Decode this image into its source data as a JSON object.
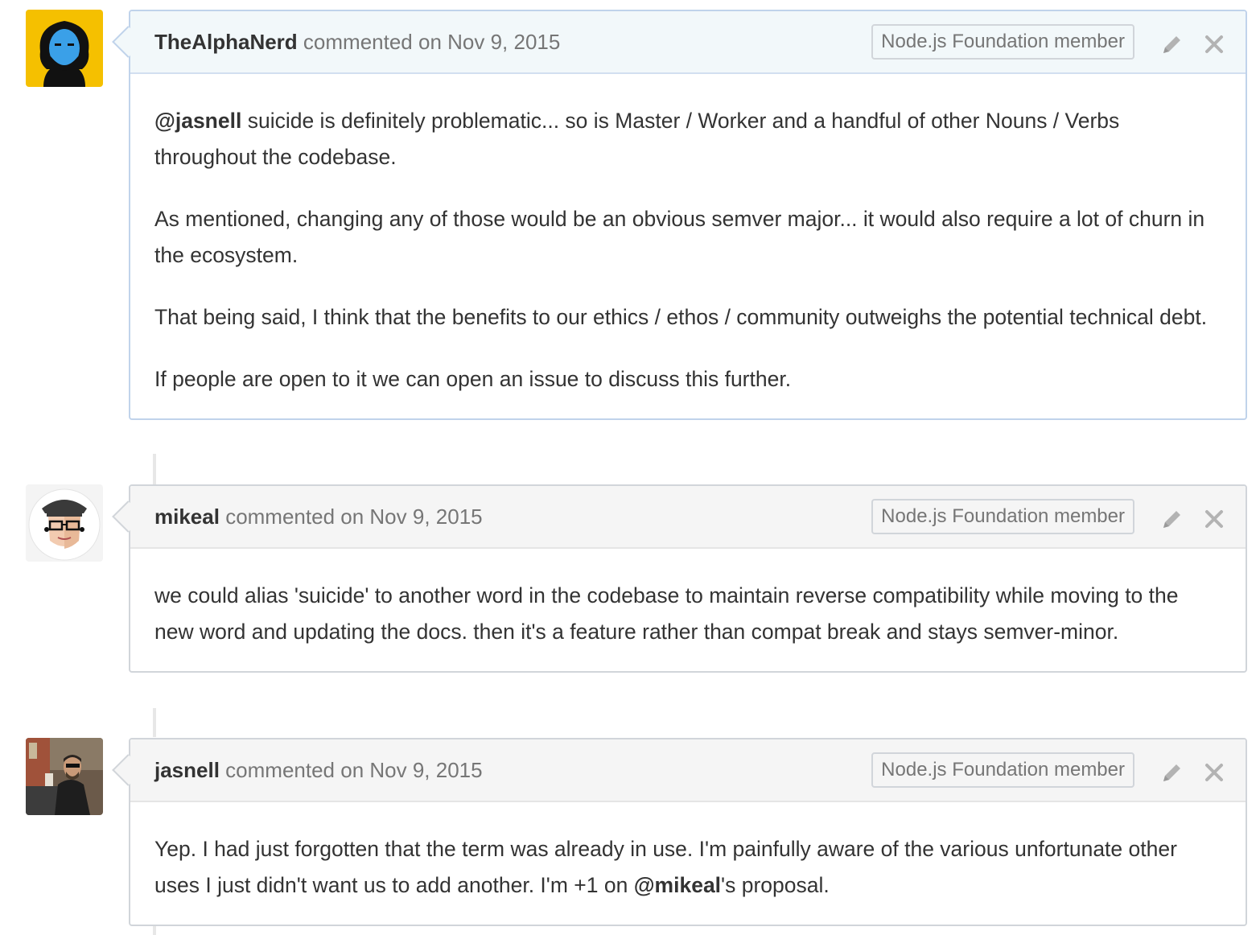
{
  "comments": [
    {
      "author": "TheAlphaNerd",
      "action": "commented on",
      "date": "Nov 9, 2015",
      "badge": "Node.js Foundation member",
      "paragraphs": [
        {
          "mention": "@jasnell",
          "text": " suicide is definitely problematic... so is Master / Worker and a handful of other Nouns / Verbs throughout the codebase."
        },
        {
          "text": "As mentioned, changing any of those would be an obvious semver major... it would also require a lot of churn in the ecosystem."
        },
        {
          "text": "That being said, I think that the benefits to our ethics / ethos / community outweighs the potential technical debt."
        },
        {
          "text": "If people are open to it we can open an issue to discuss this further."
        }
      ]
    },
    {
      "author": "mikeal",
      "action": "commented on",
      "date": "Nov 9, 2015",
      "badge": "Node.js Foundation member",
      "paragraphs": [
        {
          "text": "we could alias 'suicide' to another word in the codebase to maintain reverse compatibility while moving to the new word and updating the docs. then it's a feature rather than compat break and stays semver-minor."
        }
      ]
    },
    {
      "author": "jasnell",
      "action": "commented on",
      "date": "Nov 9, 2015",
      "badge": "Node.js Foundation member",
      "paragraphs": [
        {
          "text": "Yep. I had just forgotten that the term was already in use. I'm painfully aware of the various unfortunate other uses I just didn't want us to add another. I'm +1 on ",
          "mention_inline": "@mikeal",
          "after": "'s proposal."
        }
      ]
    }
  ],
  "icons": {
    "edit": "pencil-icon",
    "close": "close-icon"
  },
  "colors": {
    "highlight_header": "#f2f8fa",
    "default_header": "#f5f5f5",
    "border": "#d1d5da",
    "muted_text": "#767676",
    "text": "#333333",
    "avatar_yellow": "#f5c000"
  }
}
